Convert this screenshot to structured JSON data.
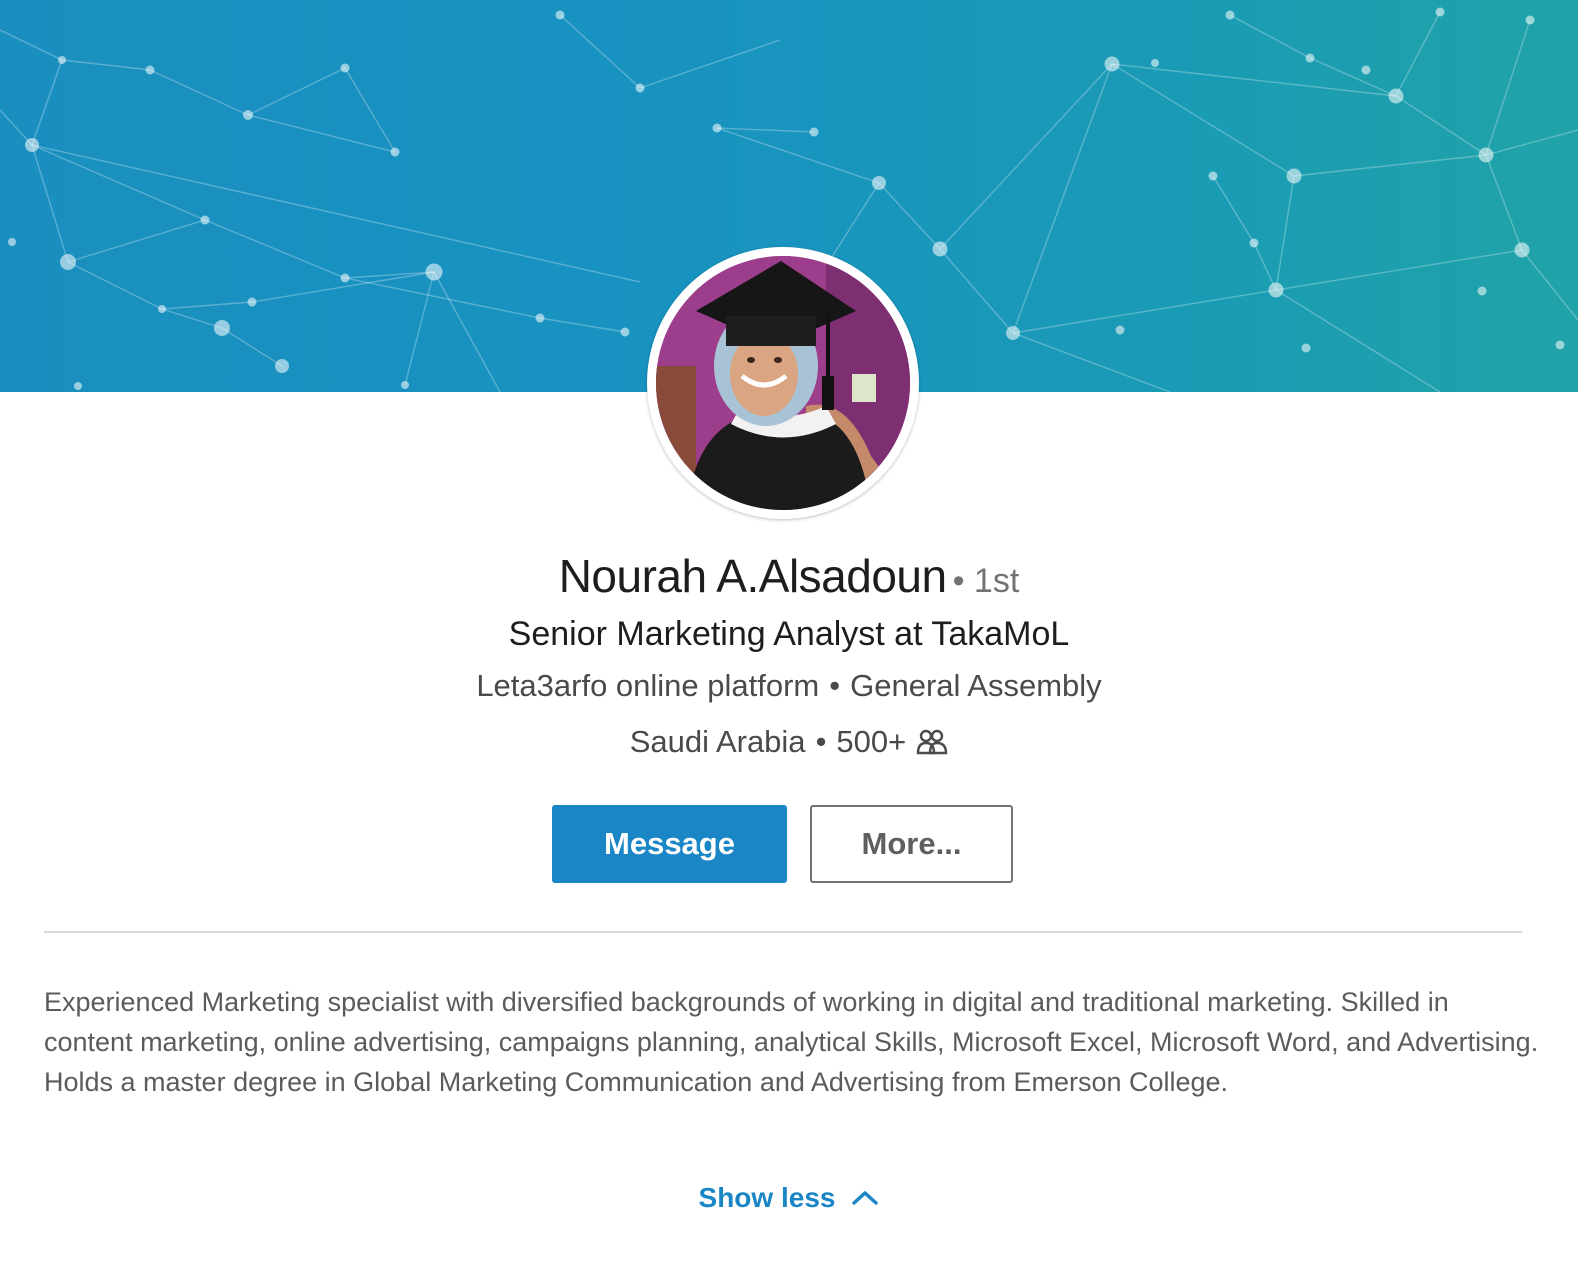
{
  "profile": {
    "name": "Nourah A.Alsadoun",
    "degree": "• 1st",
    "headline": "Senior Marketing Analyst at TakaMoL",
    "company": "Leta3arfo online platform",
    "education": "General Assembly",
    "location": "Saudi Arabia",
    "connections": "500+",
    "separator": "•"
  },
  "actions": {
    "message_label": "Message",
    "more_label": "More..."
  },
  "summary": {
    "text": "Experienced Marketing specialist with diversified backgrounds of working in digital and traditional marketing. Skilled in content marketing, online advertising, campaigns planning, analytical Skills, Microsoft Excel, Microsoft Word, and Advertising. Holds a master degree in Global Marketing Communication and Advertising from Emerson College.",
    "toggle_label": "Show less"
  },
  "icons": {
    "connections": "people-icon",
    "toggle": "chevron-up-icon"
  },
  "colors": {
    "accent": "#1b86c6",
    "banner_start": "#1a8fbf",
    "banner_end": "#20a3a8"
  }
}
